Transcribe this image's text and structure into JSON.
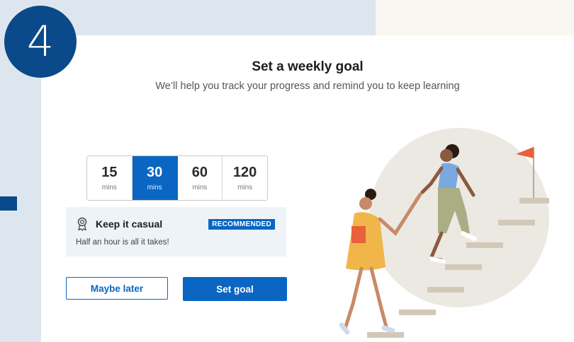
{
  "step": {
    "number": "4"
  },
  "header": {
    "title": "Set a weekly goal",
    "subtitle": "We’ll help you track your progress and remind you to keep learning"
  },
  "goal_options": [
    {
      "value": "15",
      "unit": "mins",
      "selected": false
    },
    {
      "value": "30",
      "unit": "mins",
      "selected": true
    },
    {
      "value": "60",
      "unit": "mins",
      "selected": false
    },
    {
      "value": "120",
      "unit": "mins",
      "selected": false
    }
  ],
  "selected_info": {
    "icon": "award-ribbon-icon",
    "title": "Keep it casual",
    "badge": "RECOMMENDED",
    "description": "Half an hour is all it takes!"
  },
  "buttons": {
    "maybe_later": "Maybe later",
    "set_goal": "Set goal"
  },
  "colors": {
    "accent": "#0a66c2",
    "badge_bg": "#0a4a8a",
    "panel_bg": "#eef3f8"
  }
}
